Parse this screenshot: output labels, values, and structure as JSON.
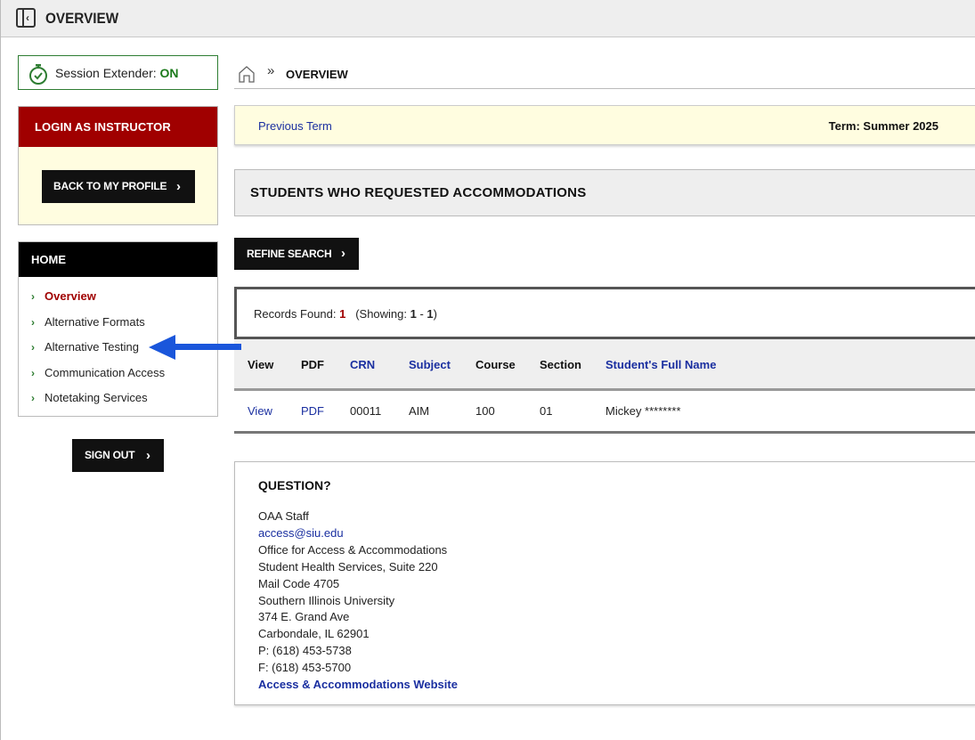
{
  "header": {
    "title": "OVERVIEW",
    "toggle_icon": "sidebar-toggle-icon"
  },
  "session": {
    "label": "Session Extender: ",
    "status": "ON",
    "icon": "stopwatch-icon"
  },
  "login_box": {
    "title": "LOGIN AS INSTRUCTOR",
    "back_button": "BACK TO MY PROFILE"
  },
  "nav": {
    "title": "HOME",
    "items": [
      {
        "label": "Overview",
        "active": true
      },
      {
        "label": "Alternative Formats"
      },
      {
        "label": "Alternative Testing"
      },
      {
        "label": "Communication Access"
      },
      {
        "label": "Notetaking Services"
      }
    ]
  },
  "sign_out": "SIGN OUT",
  "breadcrumb": {
    "separator": "»",
    "current": "OVERVIEW"
  },
  "term_bar": {
    "previous": "Previous Term",
    "term": "Term: Summer 2025"
  },
  "section_title": "STUDENTS WHO REQUESTED ACCOMMODATIONS",
  "refine_button": "REFINE SEARCH",
  "records": {
    "label": "Records Found: ",
    "count": "1",
    "showing_prefix": "(Showing: ",
    "start": "1",
    "dash": " - ",
    "end": "1",
    "close": ")"
  },
  "table": {
    "headers": [
      "View",
      "PDF",
      "CRN",
      "Subject",
      "Course",
      "Section",
      "Student's Full Name"
    ],
    "rows": [
      [
        "View",
        "PDF",
        "00011",
        "AIM",
        "100",
        "01",
        "Mickey ********"
      ]
    ]
  },
  "question": {
    "title": "QUESTION?",
    "staff": "OAA Staff",
    "email": "access@siu.edu",
    "office": "Office for Access & Accommodations",
    "building": "Student Health Services, Suite 220",
    "mail_code": "Mail Code 4705",
    "university": "Southern Illinois University",
    "street": "374 E. Grand Ave",
    "city": "Carbondale, IL 62901",
    "phone": "P: (618) 453-5738",
    "fax": "F: (618) 453-5700",
    "website": "Access & Accommodations Website"
  },
  "colors": {
    "accent_red": "#a00000",
    "link_blue": "#1a2fa0",
    "green": "#2e7d32",
    "annotation_arrow": "#1a56db"
  }
}
